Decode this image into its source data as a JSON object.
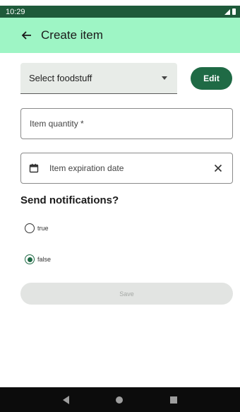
{
  "status_bar": {
    "time": "10:29",
    "signal_icon": "signal-icon",
    "battery_icon": "battery-icon"
  },
  "app_bar": {
    "title": "Create item",
    "back_icon": "arrow-back-icon",
    "background": "#9ef5c5"
  },
  "form": {
    "foodstuff_select": {
      "value": "Select foodstuff"
    },
    "edit_button": {
      "label": "Edit"
    },
    "quantity_field": {
      "placeholder": "Item quantity *"
    },
    "expiration_field": {
      "placeholder": "Item expiration date",
      "icon": "calendar-icon",
      "clear_icon": "close-icon"
    },
    "notifications": {
      "title": "Send notifications?",
      "options": [
        {
          "label": "true",
          "selected": false
        },
        {
          "label": "false",
          "selected": true
        }
      ]
    },
    "save_button": {
      "label": "Save",
      "enabled": false
    }
  },
  "colors": {
    "primary": "#1f6a45",
    "app_bar": "#9ef5c5",
    "status_bar": "#1e5a3a"
  }
}
